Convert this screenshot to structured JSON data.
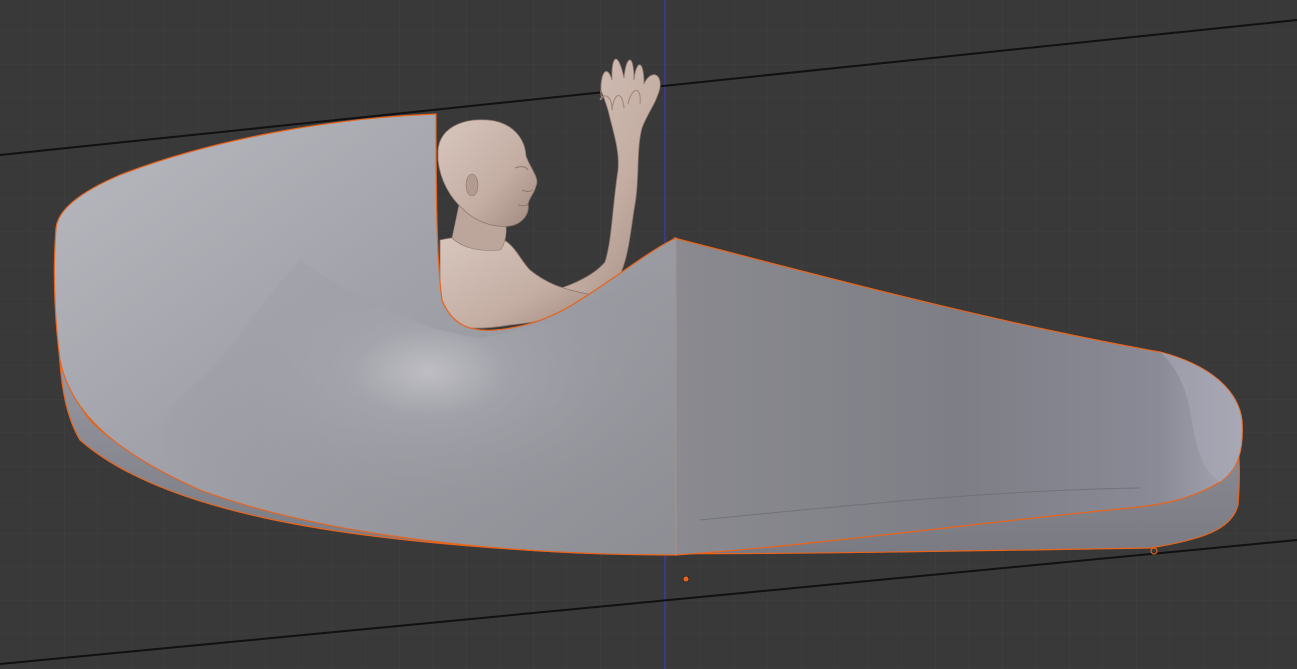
{
  "viewport": {
    "type": "3d-viewport",
    "background_color": "#393939",
    "grid_color": "#3e3e3e",
    "grid_minor_color": "#3b3b3b",
    "vertical_axis_color": "#3a3ad6",
    "guide_line_color": "#111111"
  },
  "scene": {
    "objects": [
      {
        "name": "cockpit-shell",
        "selected": true,
        "outline_color": "#e8641c",
        "base_color": "#8c8c94"
      },
      {
        "name": "pilot-figure",
        "selected": false,
        "skin_color": "#c9b5ac"
      }
    ],
    "origins": [
      {
        "name": "object-origin",
        "color": "#e8641c"
      },
      {
        "name": "vertex-marker",
        "color": "#e8641c"
      }
    ]
  }
}
